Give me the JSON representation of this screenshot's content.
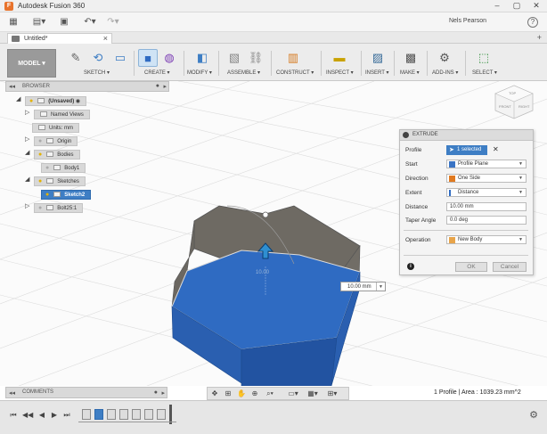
{
  "window": {
    "title": "Autodesk Fusion 360",
    "app_icon": "F",
    "controls": [
      "minimize-icon",
      "maximize-icon",
      "close-icon"
    ]
  },
  "quickbar": {
    "user": "Nels Pearson",
    "help": "?"
  },
  "tabs": {
    "doc_title": "Untitled*"
  },
  "toolbar": {
    "workspace": "MODEL",
    "groups": [
      {
        "label": "SKETCH ▾"
      },
      {
        "label": "CREATE ▾"
      },
      {
        "label": "MODIFY ▾"
      },
      {
        "label": "ASSEMBLE ▾"
      },
      {
        "label": "CONSTRUCT ▾"
      },
      {
        "label": "INSPECT ▾"
      },
      {
        "label": "INSERT ▾"
      },
      {
        "label": "MAKE ▾"
      },
      {
        "label": "ADD-INS ▾"
      },
      {
        "label": "SELECT ▾"
      }
    ]
  },
  "browser": {
    "title": "BROWSER",
    "root": "(Unsaved)",
    "items": [
      {
        "label": "Named Views"
      },
      {
        "label": "Units: mm"
      },
      {
        "label": "Origin"
      },
      {
        "label": "Bodies"
      },
      {
        "label": "Body1"
      },
      {
        "label": "Sketches"
      },
      {
        "label": "Sketch2"
      },
      {
        "label": "Bolt25:1"
      }
    ]
  },
  "viewcube": {
    "faces": [
      "TOP",
      "FRONT",
      "RIGHT"
    ]
  },
  "extrude": {
    "title": "EXTRUDE",
    "rows": [
      {
        "label": "Profile",
        "value": "1 selected"
      },
      {
        "label": "Start",
        "value": "Profile Plane"
      },
      {
        "label": "Direction",
        "value": "One Side"
      },
      {
        "label": "Extent",
        "value": "Distance"
      },
      {
        "label": "Distance",
        "value": "10.00 mm"
      },
      {
        "label": "Taper Angle",
        "value": "0.0 deg"
      },
      {
        "label": "Operation",
        "value": "New Body"
      }
    ],
    "ok": "OK",
    "cancel": "Cancel",
    "info": "i",
    "clear": "✕"
  },
  "canvas": {
    "distance_tag": "10.00 mm",
    "dimension_ghost": "10.00"
  },
  "comments": {
    "title": "COMMENTS"
  },
  "status": {
    "text": "1 Profile | Area : 1039.23 mm^2"
  },
  "colors": {
    "accent_blue": "#3e7ec4",
    "body_top": "#2f6bc2",
    "body_side": "#2253a1",
    "extrude_preview": "#6e6a63",
    "arrow": "#2f8fd1",
    "app_orange": "#e8732c"
  }
}
